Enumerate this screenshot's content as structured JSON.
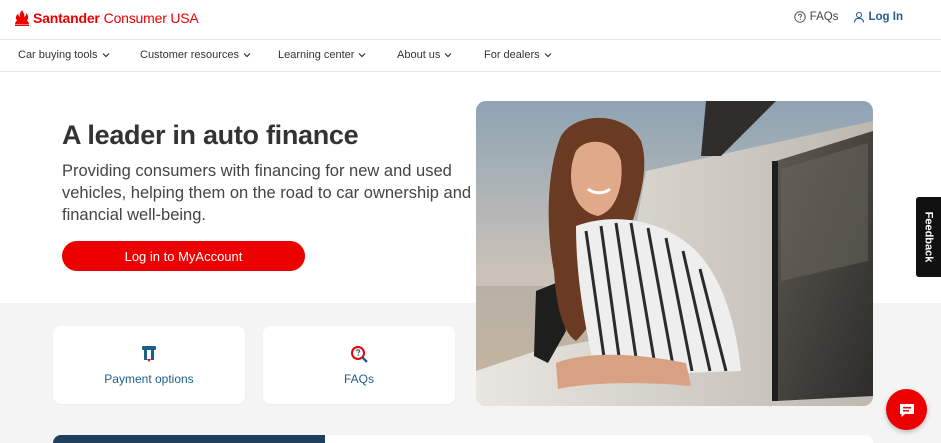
{
  "header": {
    "brand_bold": "Santander",
    "brand_regular": "Consumer USA",
    "faqs_label": "FAQs",
    "login_label": "Log In"
  },
  "nav": {
    "items": [
      {
        "label": "Car buying tools"
      },
      {
        "label": "Customer resources"
      },
      {
        "label": "Learning center"
      },
      {
        "label": "About us"
      },
      {
        "label": "For dealers"
      }
    ]
  },
  "hero": {
    "title": "A leader in auto finance",
    "subtitle": "Providing consumers with financing for new and used vehicles, helping them on the road to car ownership and financial well-being.",
    "cta_label": "Log in to MyAccount"
  },
  "cards": [
    {
      "label": "Payment options",
      "icon": "payment-icon"
    },
    {
      "label": "FAQs",
      "icon": "faq-search-icon"
    }
  ],
  "feedback": {
    "label": "Feedback"
  },
  "colors": {
    "brand_red": "#ec0000",
    "link_blue": "#1d5f8a",
    "grey_bg": "#f4f4f4"
  }
}
